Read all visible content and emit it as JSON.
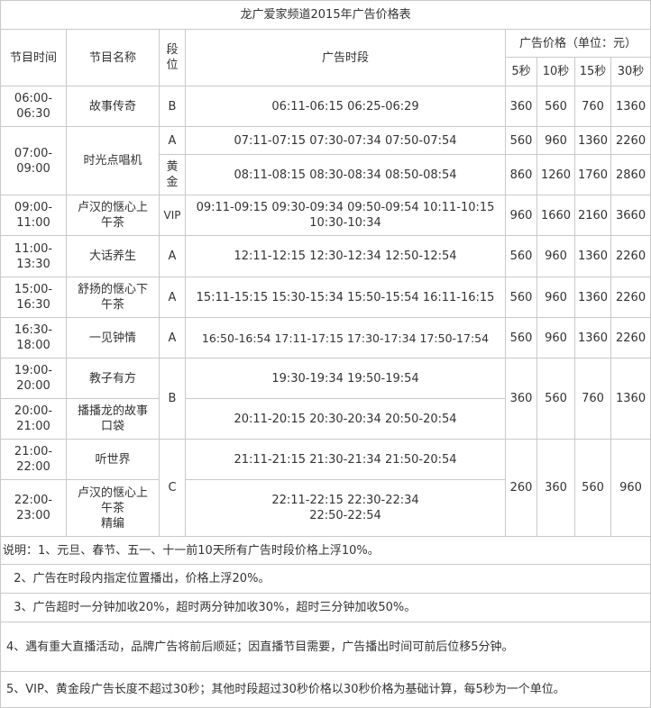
{
  "title": "龙广爱家频道2015年广告价格表",
  "headers": {
    "time": "节目时间",
    "name": "节目名称",
    "grade": "段位",
    "slots": "广告时段",
    "price": "广告价格（单位：元）",
    "p5": "5秒",
    "p10": "10秒",
    "p15": "15秒",
    "p30": "30秒"
  },
  "rows": [
    {
      "time": "06:00-\n06:30",
      "name": "故事传奇",
      "grade": "B",
      "slots": "06:11-06:15  06:25-06:29",
      "p5": "360",
      "p10": "560",
      "p15": "760",
      "p30": "1360"
    },
    {
      "time": "07:00-\n09:00",
      "name": "时光点唱机",
      "grade": "A",
      "slots": "07:11-07:15  07:30-07:34  07:50-07:54",
      "p5": "560",
      "p10": "960",
      "p15": "1360",
      "p30": "2260"
    },
    {
      "grade": "黄\n金",
      "slots": "08:11-08:15  08:30-08:34  08:50-08:54",
      "p5": "860",
      "p10": "1260",
      "p15": "1760",
      "p30": "2860"
    },
    {
      "time": "09:00-\n11:00",
      "name": "卢汉的惬心上\n午茶",
      "grade": "VIP",
      "slots": "09:11-09:15  09:30-09:34  09:50-09:54  10:11-10:15\n10:30-10:34",
      "p5": "960",
      "p10": "1660",
      "p15": "2160",
      "p30": "3660"
    },
    {
      "time": "11:00-\n13:30",
      "name": "大话养生",
      "grade": "A",
      "slots": "12:11-12:15  12:30-12:34  12:50-12:54",
      "p5": "560",
      "p10": "960",
      "p15": "1360",
      "p30": "2260"
    },
    {
      "time": "15:00-\n16:30",
      "name": "舒扬的惬心下\n午茶",
      "grade": "A",
      "slots": "15:11-15:15  15:30-15:34  15:50-15:54  16:11-16:15",
      "p5": "560",
      "p10": "960",
      "p15": "1360",
      "p30": "2260"
    },
    {
      "time": "16:30-\n18:00",
      "name": "一见钟情",
      "grade": "A",
      "slots": "16:50-16:54  17:11-17:15  17:30-17:34  17:50-17:54",
      "p5": "560",
      "p10": "960",
      "p15": "1360",
      "p30": "2260"
    },
    {
      "time": "19:00-\n20:00",
      "name": "教子有方",
      "grade": "B",
      "slots": "19:30-19:34  19:50-19:54",
      "p5": "360",
      "p10": "560",
      "p15": "760",
      "p30": "1360"
    },
    {
      "time": "20:00-\n21:00",
      "name": "播播龙的故事\n口袋",
      "slots": "20:11-20:15  20:30-20:34  20:50-20:54"
    },
    {
      "time": "21:00-\n22:00",
      "name": "听世界",
      "grade": "C",
      "slots": "21:11-21:15  21:30-21:34  21:50-20:54",
      "p5": "260",
      "p10": "360",
      "p15": "560",
      "p30": "960"
    },
    {
      "time": "22:00-\n23:00",
      "name": "卢汉的惬心上\n午茶\n精编",
      "slots": "22:11-22:15  22:30-22:34\n22:50-22:54"
    }
  ],
  "notes": [
    "说明：1、元旦、春节、五一、十一前10天所有广告时段价格上浮10%。",
    "  2、广告在时段内指定位置播出，价格上浮20%。",
    "  3、广告超时一分钟加收20%，超时两分钟加收30%，超时三分钟加收50%。",
    "4、遇有重大直播活动，品牌广告将前后顺延；因直播节目需要，广告播出时间可前后位移5分钟。",
    "5、VIP、黄金段广告长度不超过30秒；其他时段超过30秒价格以30秒价格为基础计算，每5秒为一个单位。"
  ]
}
